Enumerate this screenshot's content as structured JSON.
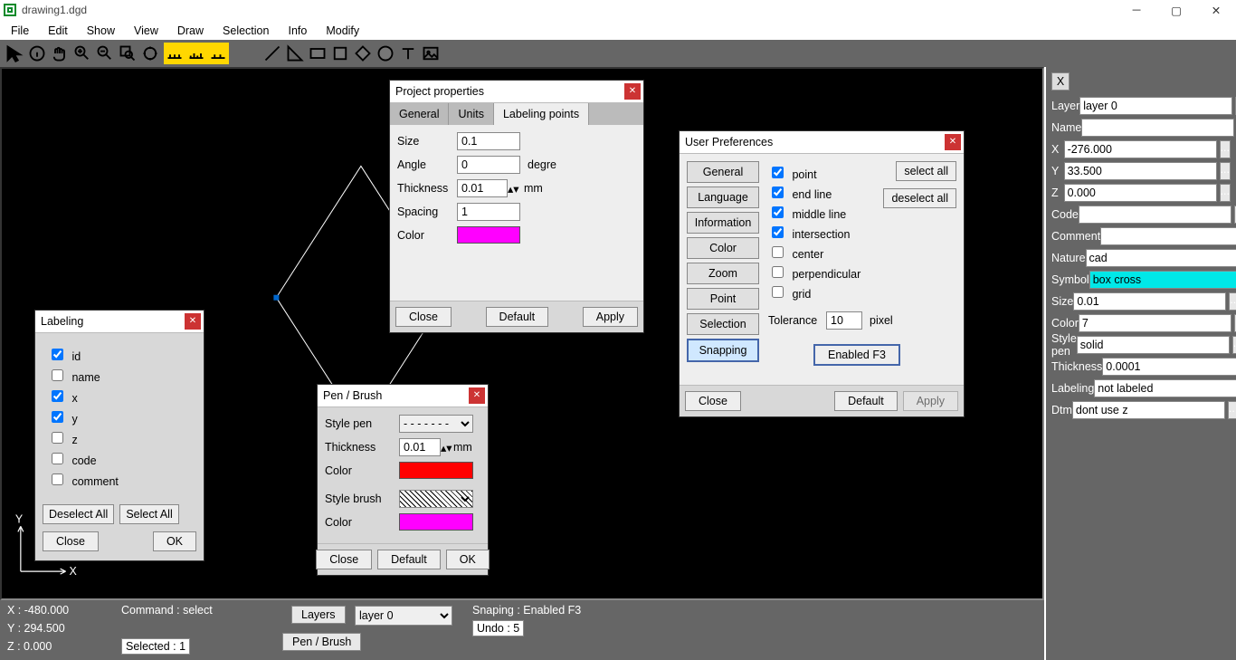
{
  "title": "drawing1.dgd",
  "menu": [
    "File",
    "Edit",
    "Show",
    "View",
    "Draw",
    "Selection",
    "Info",
    "Modify"
  ],
  "rightPanel": {
    "close": "X",
    "rows": [
      {
        "k": "layer",
        "label": "Layer",
        "val": "layer 0"
      },
      {
        "k": "name",
        "label": "Name",
        "val": ""
      },
      {
        "k": "x",
        "label": "X",
        "val": "-276.000"
      },
      {
        "k": "y",
        "label": "Y",
        "val": "33.500"
      },
      {
        "k": "z",
        "label": "Z",
        "val": "0.000"
      },
      {
        "k": "code",
        "label": "Code",
        "val": ""
      },
      {
        "k": "comment",
        "label": "Comment",
        "val": ""
      },
      {
        "k": "nature",
        "label": "Nature",
        "val": "cad"
      },
      {
        "k": "symbol",
        "label": "Symbol",
        "val": "box cross",
        "hl": true
      },
      {
        "k": "size",
        "label": "Size",
        "val": "0.01"
      },
      {
        "k": "color",
        "label": "Color",
        "val": "7"
      },
      {
        "k": "stylepen",
        "label": "Style pen",
        "val": "solid"
      },
      {
        "k": "thickness",
        "label": "Thickness",
        "val": "0.0001"
      },
      {
        "k": "labeling",
        "label": "Labeling",
        "val": "not labeled"
      },
      {
        "k": "dtm",
        "label": "Dtm",
        "val": "dont use z"
      }
    ]
  },
  "status": {
    "x": "X : -480.000",
    "y": "Y : 294.500",
    "z": "Z : 0.000",
    "command": "Command : select",
    "selected": "Selected : 1",
    "layers_btn": "Layers",
    "layer_sel": "layer 0",
    "snapping": "Snaping : Enabled  F3",
    "undo": "Undo : 5",
    "penbrush": "Pen / Brush"
  },
  "labelingDlg": {
    "title": "Labeling",
    "items": [
      {
        "k": "id",
        "label": "id",
        "checked": true
      },
      {
        "k": "name",
        "label": "name",
        "checked": false
      },
      {
        "k": "x",
        "label": "x",
        "checked": true
      },
      {
        "k": "y",
        "label": "y",
        "checked": true
      },
      {
        "k": "z",
        "label": "z",
        "checked": false
      },
      {
        "k": "code",
        "label": "code",
        "checked": false
      },
      {
        "k": "comment",
        "label": "comment",
        "checked": false
      }
    ],
    "deselect": "Deselect All",
    "select": "Select All",
    "close": "Close",
    "ok": "OK"
  },
  "penDlg": {
    "title": "Pen / Brush",
    "stylepen_lbl": "Style pen",
    "thickness_lbl": "Thickness",
    "thickness": "0.01",
    "mm": "mm",
    "color_lbl": "Color",
    "pen_color": "#ff0000",
    "stylebrush_lbl": "Style brush",
    "brush_color_lbl": "Color",
    "brush_color": "#ff00ff",
    "close": "Close",
    "default": "Default",
    "ok": "OK"
  },
  "projDlg": {
    "title": "Project properties",
    "tabs": [
      "General",
      "Units",
      "Labeling points"
    ],
    "active": 2,
    "size_lbl": "Size",
    "size": "0.1",
    "angle_lbl": "Angle",
    "angle": "0",
    "degre": "degre",
    "thickness_lbl": "Thickness",
    "thickness": "0.01",
    "mm": "mm",
    "spacing_lbl": "Spacing",
    "spacing": "1",
    "color_lbl": "Color",
    "color": "#ff00ff",
    "close": "Close",
    "default": "Default",
    "apply": "Apply"
  },
  "prefDlg": {
    "title": "User Preferences",
    "sidetabs": [
      "General",
      "Language",
      "Information",
      "Color",
      "Zoom",
      "Point",
      "Selection",
      "Snapping"
    ],
    "active": 7,
    "checks": [
      {
        "k": "point",
        "label": "point",
        "c": true
      },
      {
        "k": "endline",
        "label": "end line",
        "c": true
      },
      {
        "k": "middleline",
        "label": "middle line",
        "c": true
      },
      {
        "k": "intersection",
        "label": "intersection",
        "c": true
      },
      {
        "k": "center",
        "label": "center",
        "c": false
      },
      {
        "k": "perpendicular",
        "label": "perpendicular",
        "c": false
      },
      {
        "k": "grid",
        "label": "grid",
        "c": false
      }
    ],
    "selectall": "select all",
    "deselectall": "deselect all",
    "tolerance_lbl": "Tolerance",
    "tolerance": "10",
    "pixel": "pixel",
    "enabled": "Enabled  F3",
    "close": "Close",
    "default": "Default",
    "apply": "Apply"
  }
}
